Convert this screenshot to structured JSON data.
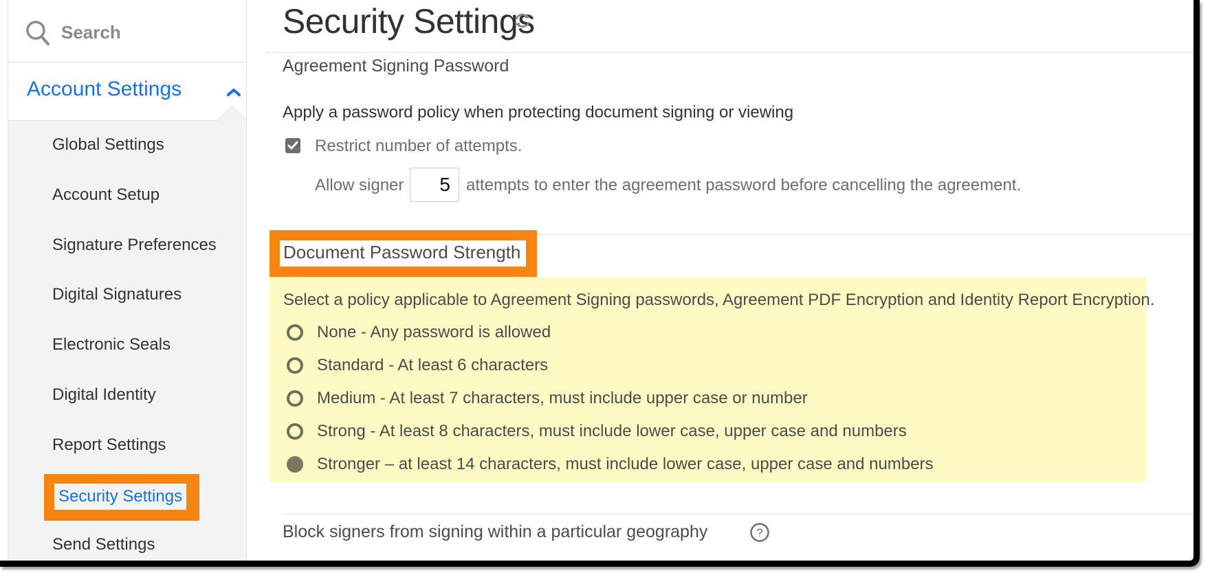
{
  "sidebar": {
    "search_placeholder": "Search",
    "section": {
      "label": "Account Settings",
      "expanded": true
    },
    "items": [
      {
        "label": "Global Settings"
      },
      {
        "label": "Account Setup"
      },
      {
        "label": "Signature Preferences"
      },
      {
        "label": "Digital Signatures"
      },
      {
        "label": "Electronic Seals"
      },
      {
        "label": "Digital Identity"
      },
      {
        "label": "Report Settings"
      },
      {
        "label": "Security Settings",
        "active": true
      },
      {
        "label": "Send Settings"
      }
    ]
  },
  "main": {
    "title": "Security Settings",
    "agreement_signing_password": {
      "title": "Agreement Signing Password",
      "policy_text": "Apply a password policy when protecting document signing or viewing",
      "restrict_checkbox": {
        "label": "Restrict number of attempts.",
        "checked": true
      },
      "allow_prefix": "Allow signer",
      "attempts_value": "5",
      "allow_suffix": "attempts to enter the agreement password before cancelling the agreement."
    },
    "document_password_strength": {
      "title": "Document Password Strength",
      "description": "Select a policy applicable to Agreement Signing passwords, Agreement PDF Encryption and Identity Report Encryption.",
      "options": [
        {
          "label": "None - Any password is allowed",
          "selected": false
        },
        {
          "label": "Standard - At least 6 characters",
          "selected": false
        },
        {
          "label": "Medium - At least 7 characters, must include upper case or number",
          "selected": false
        },
        {
          "label": "Strong - At least 8 characters, must include lower case, upper case and numbers",
          "selected": false
        },
        {
          "label": "Stronger – at least 14 characters, must include lower case, upper case and numbers",
          "selected": true
        }
      ]
    },
    "geo_block": {
      "title": "Block signers from signing within a particular geography"
    }
  },
  "colors": {
    "accent": "#1473e6",
    "highlight": "#f68511",
    "highlight_bg": "#fff9c4"
  }
}
